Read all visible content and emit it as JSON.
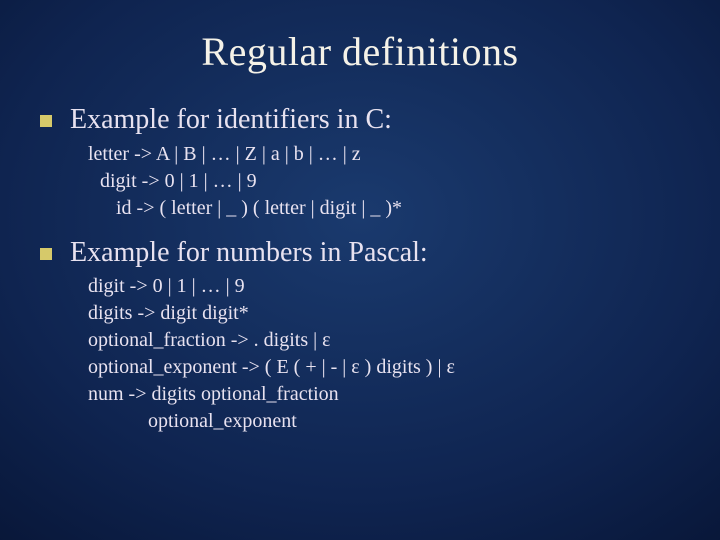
{
  "title": "Regular definitions",
  "sections": [
    {
      "heading": "Example for identifiers in C:",
      "lines": [
        {
          "cls": "",
          "text": "letter -> A | B | … | Z | a | b | … | z"
        },
        {
          "cls": "indent1",
          "text": "digit -> 0 | 1 | … | 9"
        },
        {
          "cls": "indent2",
          "text": "id -> ( letter | _ ) ( letter | digit | _ )*"
        }
      ]
    },
    {
      "heading": "Example for numbers in Pascal:",
      "lines": [
        {
          "cls": "",
          "text": "digit -> 0 | 1 | … | 9"
        },
        {
          "cls": "",
          "text": "digits -> digit digit*"
        },
        {
          "cls": "",
          "text": "optional_fraction -> . digits | ε"
        },
        {
          "cls": "",
          "text": "optional_exponent -> ( E ( + | - | ε ) digits ) | ε"
        },
        {
          "cls": "",
          "text": "num -> digits optional_fraction"
        },
        {
          "cls": "indent3",
          "text": "optional_exponent"
        }
      ]
    }
  ]
}
